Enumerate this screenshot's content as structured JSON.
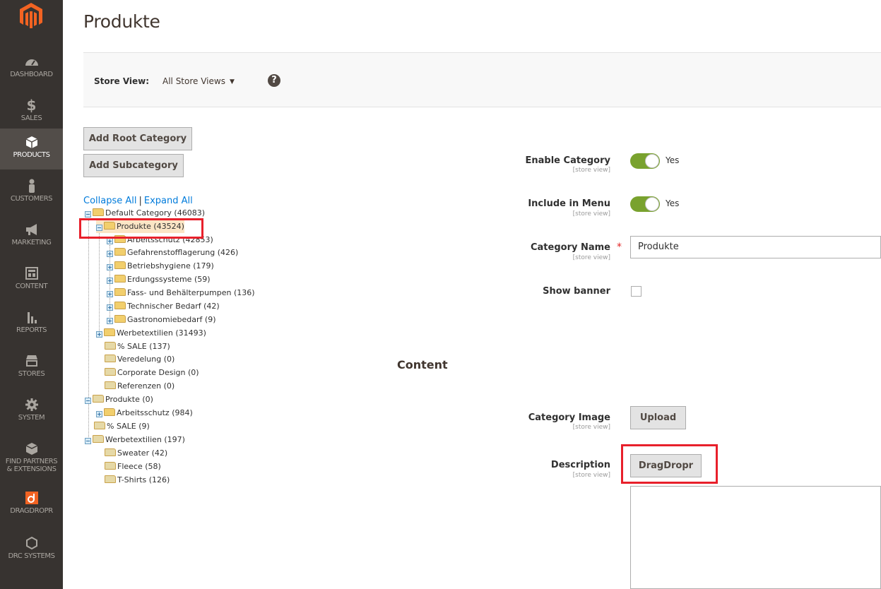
{
  "page": {
    "title": "Produkte"
  },
  "sidebar": {
    "items": [
      {
        "label": "DASHBOARD",
        "icon": "dashboard-icon"
      },
      {
        "label": "SALES",
        "icon": "dollar-icon"
      },
      {
        "label": "PRODUCTS",
        "icon": "cube-icon"
      },
      {
        "label": "CUSTOMERS",
        "icon": "person-icon"
      },
      {
        "label": "MARKETING",
        "icon": "megaphone-icon"
      },
      {
        "label": "CONTENT",
        "icon": "layout-icon"
      },
      {
        "label": "REPORTS",
        "icon": "bar-chart-icon"
      },
      {
        "label": "STORES",
        "icon": "storefront-icon"
      },
      {
        "label": "SYSTEM",
        "icon": "gear-icon"
      },
      {
        "label": "FIND PARTNERS",
        "label2": "& EXTENSIONS",
        "icon": "box-icon"
      },
      {
        "label": "DRAGDROPR",
        "icon": "dragdropr-icon"
      },
      {
        "label": "DRC SYSTEMS",
        "icon": "hexagon-icon"
      }
    ],
    "colors": {
      "bg": "#373330",
      "active": "#524d49",
      "logo": "#f26322",
      "dragdropr": "#f26322"
    }
  },
  "store_view": {
    "label": "Store View:",
    "value": "All Store Views",
    "help": "?"
  },
  "buttons": {
    "add_root": "Add Root Category",
    "add_sub": "Add Subcategory",
    "upload": "Upload",
    "dragdropr": "DragDropr"
  },
  "tree": {
    "collapse": "Collapse All",
    "separator": "|",
    "expand": "Expand All",
    "nodes": [
      "Default Category (46083)",
      "Produkte (43524)",
      "Arbeitsschutz (42853)",
      "Gefahrenstofflagerung (426)",
      "Betriebshygiene (179)",
      "Erdungssysteme (59)",
      "Fass- und Behälterpumpen (136)",
      "Technischer Bedarf (42)",
      "Gastronomiebedarf (9)",
      "Werbetextilien (31493)",
      "% SALE (137)",
      "Veredelung (0)",
      "Corporate Design (0)",
      "Referenzen (0)",
      "Produkte (0)",
      "Arbeitsschutz (984)",
      "% SALE (9)",
      "Werbetextilien (197)",
      "Sweater (42)",
      "Fleece (58)",
      "T-Shirts (126)"
    ]
  },
  "form": {
    "scope": "[store view]",
    "enable_category": {
      "label": "Enable Category",
      "value": "Yes"
    },
    "include_in_menu": {
      "label": "Include in Menu",
      "value": "Yes"
    },
    "category_name": {
      "label": "Category Name",
      "required": "*",
      "value": "Produkte"
    },
    "show_banner": {
      "label": "Show banner"
    },
    "content_title": "Content",
    "category_image": {
      "label": "Category Image"
    },
    "description": {
      "label": "Description"
    }
  },
  "colors": {
    "toggle_on": "#79a22e",
    "highlight": "#e8202b",
    "link": "#007bdb"
  }
}
